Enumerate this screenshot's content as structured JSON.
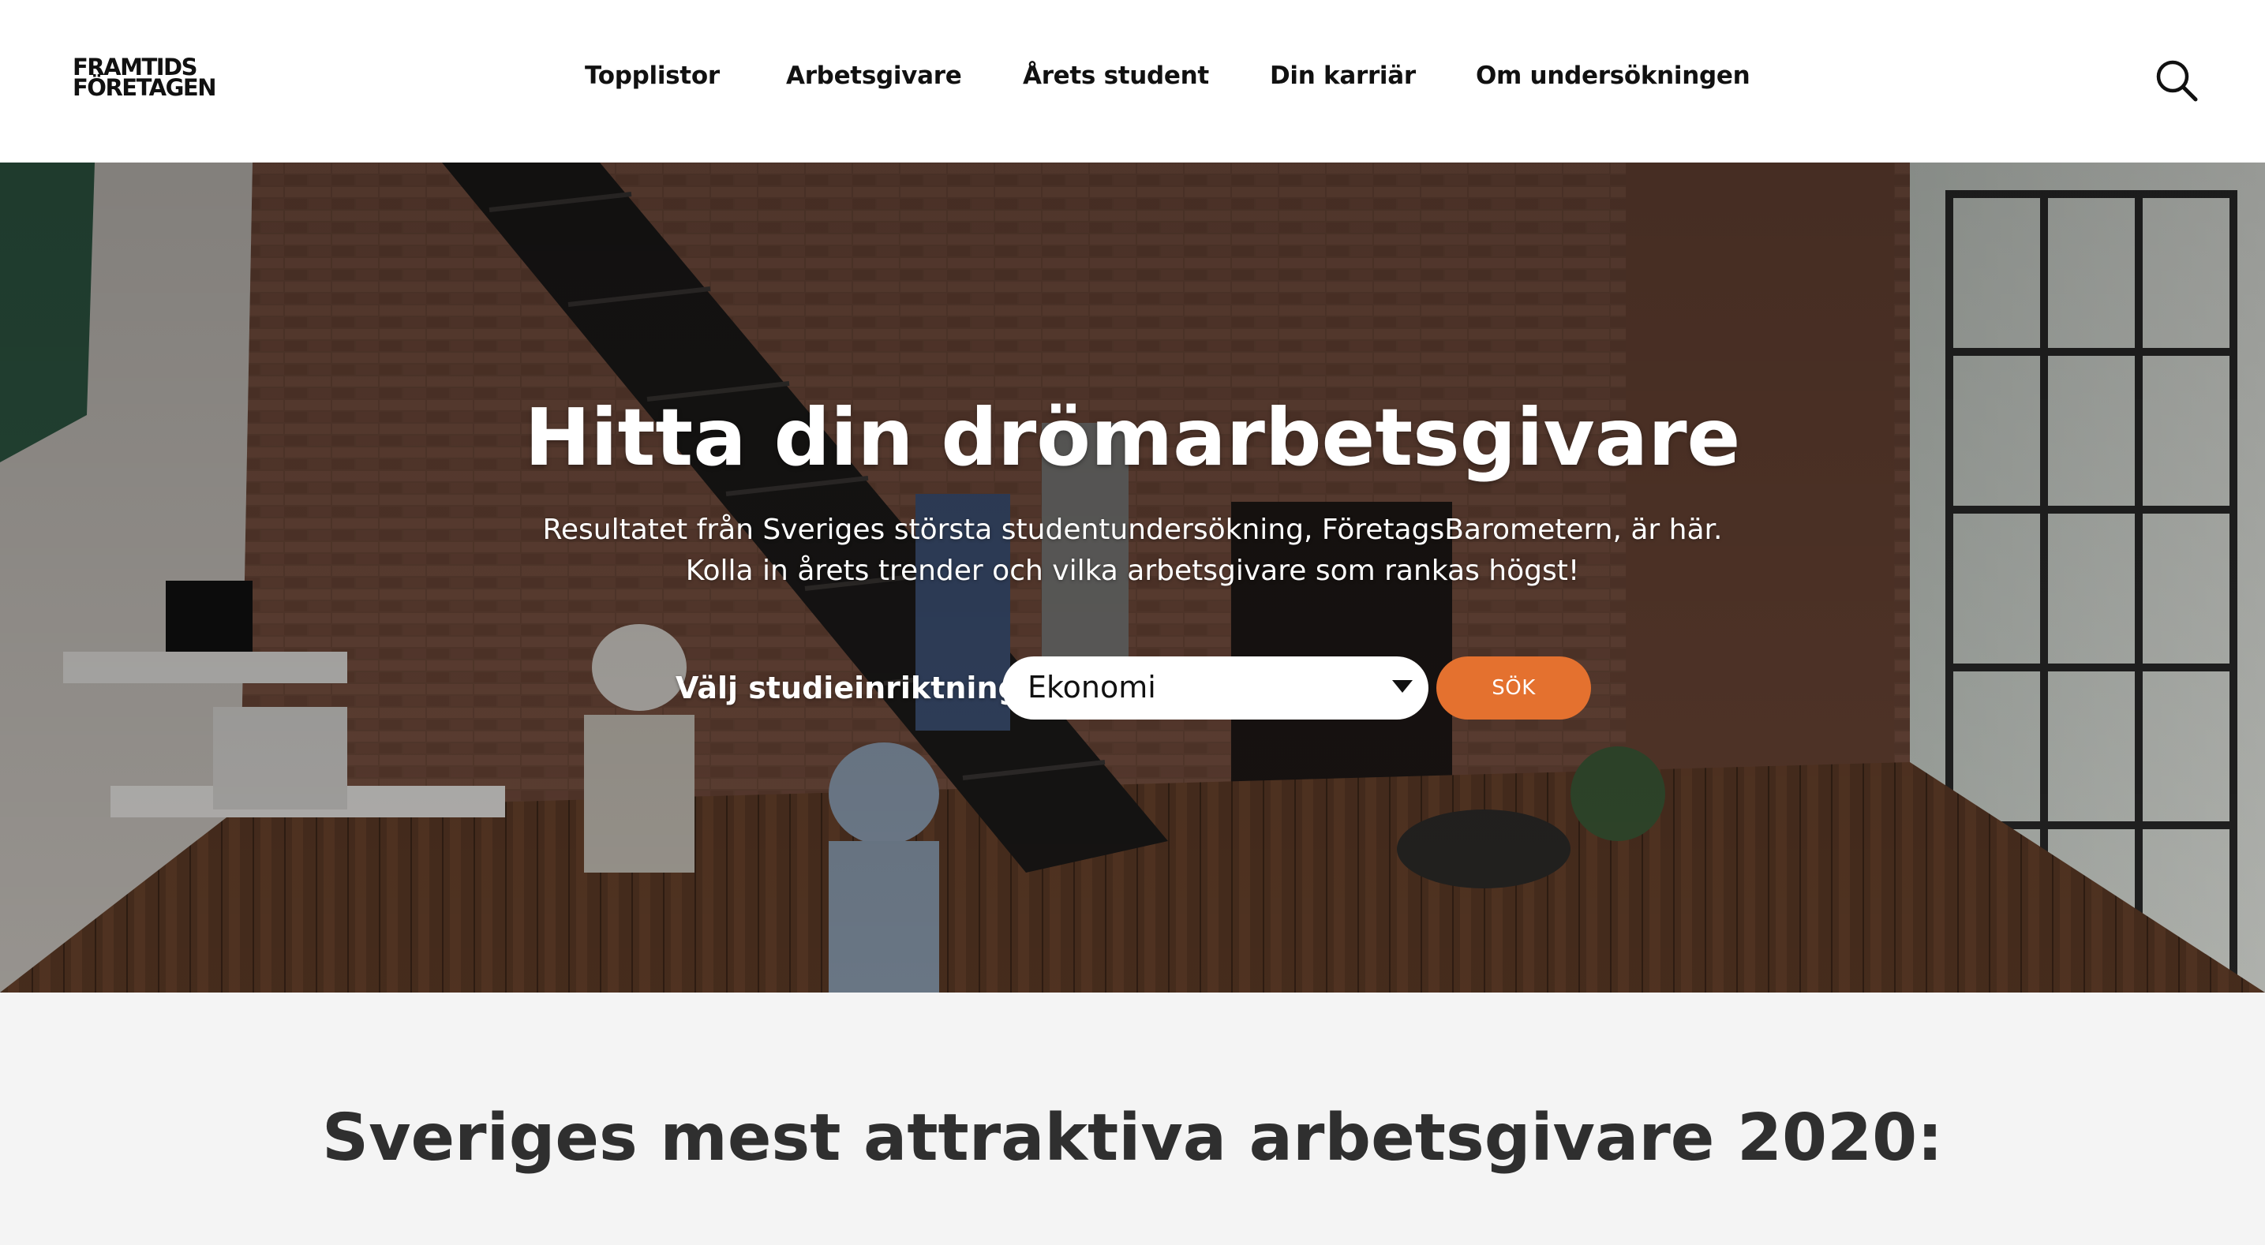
{
  "brand": {
    "logo_line1": "FRAMTIDS",
    "logo_line2": "FÖRETAGEN"
  },
  "nav": {
    "items": [
      {
        "label": "Topplistor"
      },
      {
        "label": "Arbetsgivare"
      },
      {
        "label": "Årets student"
      },
      {
        "label": "Din karriär"
      },
      {
        "label": "Om undersökningen"
      }
    ],
    "search_icon": "search-icon"
  },
  "hero": {
    "title": "Hitta din drömarbetsgivare",
    "subtitle": "Resultatet från Sveriges största studentundersökning, FöretagsBarometern, är här. Kolla in årets trender och vilka arbetsgivare som rankas högst!",
    "filter_label": "Välj studieinriktning",
    "select_value": "Ekonomi",
    "submit_label": "SÖK"
  },
  "section": {
    "title": "Sveriges mest attraktiva arbetsgivare 2020:"
  },
  "colors": {
    "accent": "#e4712f",
    "header_bg": "#ffffff",
    "page_bg": "#f4f4f4",
    "heading_text": "#2f2f2f"
  }
}
